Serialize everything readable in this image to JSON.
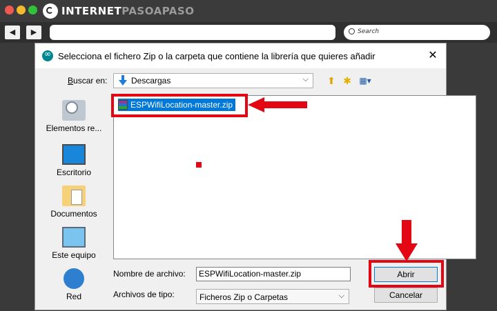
{
  "browser": {
    "logo_part1": "INTERNET",
    "logo_part2": "PASOAPASO",
    "back_icon": "◀",
    "forward_icon": "▶",
    "search_placeholder": "Search"
  },
  "dialog": {
    "title": "Selecciona el fichero Zip o la carpeta que contiene la librería que quieres añadir",
    "close_symbol": "✕",
    "lookin_label_accel": "B",
    "lookin_label_rest": "uscar en:",
    "lookin_value": "Descargas",
    "places": [
      {
        "label": "Elementos re...",
        "icon": "recent-items-icon"
      },
      {
        "label": "Escritorio",
        "icon": "desktop-icon"
      },
      {
        "label": "Documentos",
        "icon": "documents-icon"
      },
      {
        "label": "Este equipo",
        "icon": "this-pc-icon"
      },
      {
        "label": "Red",
        "icon": "network-icon"
      }
    ],
    "files": [
      {
        "name": "ESPWifiLocation-master.zip",
        "selected": true
      }
    ],
    "filename_label": "Nombre de archivo:",
    "filename_value": "ESPWifiLocation-master.zip",
    "filetype_label": "Archivos de tipo:",
    "filetype_value": "Ficheros Zip o Carpetas",
    "open_button": "Abrir",
    "cancel_button": "Cancelar"
  },
  "colors": {
    "selection": "#0078d7",
    "annotation_red": "#e30613",
    "dialog_bg": "#f0f0f0"
  }
}
